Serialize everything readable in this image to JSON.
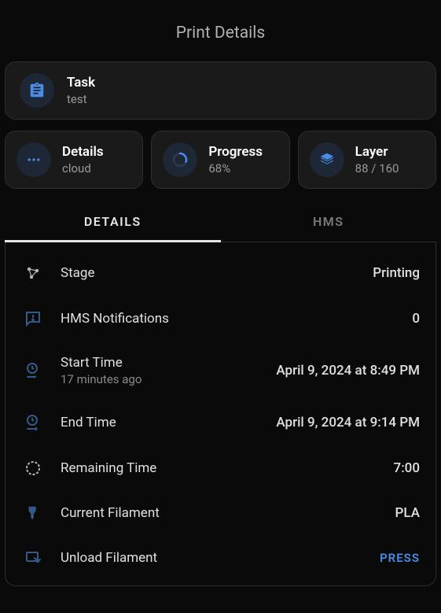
{
  "page_title": "Print Details",
  "task": {
    "title": "Task",
    "value": "test"
  },
  "stats": {
    "details": {
      "title": "Details",
      "value": "cloud"
    },
    "progress": {
      "title": "Progress",
      "value": "68%"
    },
    "layer": {
      "title": "Layer",
      "value": "88 / 160"
    }
  },
  "tabs": {
    "details": "DETAILS",
    "hms": "HMS"
  },
  "details": {
    "stage": {
      "label": "Stage",
      "value": "Printing"
    },
    "hms_notifications": {
      "label": "HMS Notifications",
      "value": "0"
    },
    "start_time": {
      "label": "Start Time",
      "sublabel": "17 minutes ago",
      "value": "April 9, 2024 at 8:49 PM"
    },
    "end_time": {
      "label": "End Time",
      "value": "April 9, 2024 at 9:14 PM"
    },
    "remaining_time": {
      "label": "Remaining Time",
      "value": "7:00"
    },
    "current_filament": {
      "label": "Current Filament",
      "value": "PLA"
    },
    "unload_filament": {
      "label": "Unload Filament",
      "value": "PRESS"
    }
  },
  "colors": {
    "accent": "#4a8de8",
    "icon_outline": "#355985"
  }
}
